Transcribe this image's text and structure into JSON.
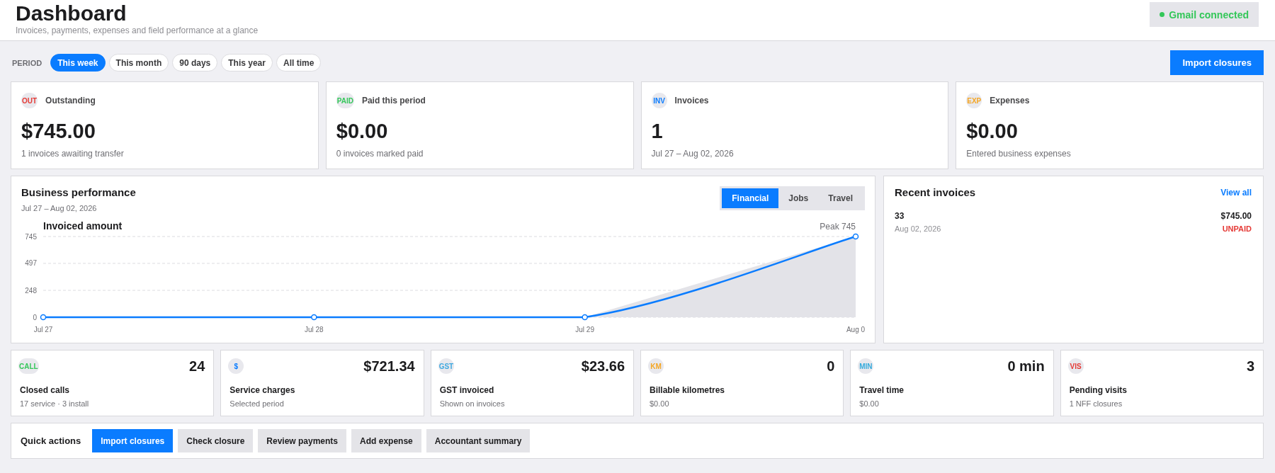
{
  "header": {
    "title": "Dashboard",
    "subtitle": "Invoices, payments, expenses and field performance at a glance",
    "connection": {
      "label": "Gmail connected",
      "connected": true
    }
  },
  "period": {
    "label": "PERIOD",
    "options": [
      {
        "label": "This week",
        "selected": true
      },
      {
        "label": "This month",
        "selected": false
      },
      {
        "label": "90 days",
        "selected": false
      },
      {
        "label": "This year",
        "selected": false
      },
      {
        "label": "All time",
        "selected": false
      }
    ],
    "action": "Import closures"
  },
  "summary_cards": [
    {
      "tag": "OUT",
      "color": "#e53935",
      "label": "Outstanding",
      "value": "$745.00",
      "note": "1 invoices awaiting transfer"
    },
    {
      "tag": "PAID",
      "color": "#34c759",
      "label": "Paid this period",
      "value": "$0.00",
      "note": "0 invoices marked paid"
    },
    {
      "tag": "INV",
      "color": "#0a7cff",
      "label": "Invoices",
      "value": "1",
      "note": "Jul 27 – Aug 02, 2026"
    },
    {
      "tag": "EXP",
      "color": "#f5a623",
      "label": "Expenses",
      "value": "$0.00",
      "note": "Entered business expenses"
    }
  ],
  "performance": {
    "title": "Business performance",
    "range": "Jul 27 – Aug 02, 2026",
    "tabs": [
      {
        "label": "Financial",
        "selected": true
      },
      {
        "label": "Jobs",
        "selected": false
      },
      {
        "label": "Travel",
        "selected": false
      }
    ],
    "chart_data": {
      "type": "area",
      "categories": [
        "Jul 27",
        "Jul 28",
        "Jul 29",
        "Aug 0"
      ],
      "series": [
        {
          "name": "Invoiced amount",
          "color": "#0a7cff",
          "values": [
            0,
            0,
            0,
            745
          ]
        }
      ],
      "ylim": [
        0,
        745
      ],
      "yticks": [
        0,
        248,
        497,
        745
      ],
      "annotations": [
        {
          "text": "Peak 745"
        }
      ]
    }
  },
  "recent_invoices": {
    "title": "Recent invoices",
    "link": "View all",
    "items": [
      {
        "number": "33",
        "amount": "$745.00",
        "date": "Aug 02, 2026",
        "status": "UNPAID",
        "color": "#e53935"
      }
    ]
  },
  "metrics": [
    {
      "tag": "CALL",
      "color": "#34c759",
      "value": "24",
      "label": "Closed calls",
      "note": "17 service · 3 install"
    },
    {
      "tag": "$",
      "color": "#0a7cff",
      "value": "$721.34",
      "label": "Service charges",
      "note": "Selected period"
    },
    {
      "tag": "GST",
      "color": "#3fa9e0",
      "value": "$23.66",
      "label": "GST invoiced",
      "note": "Shown on invoices"
    },
    {
      "tag": "KM",
      "color": "#f5a623",
      "value": "0",
      "label": "Billable kilometres",
      "note": "$0.00"
    },
    {
      "tag": "MIN",
      "color": "#34aadc",
      "value": "0 min",
      "label": "Travel time",
      "note": "$0.00"
    },
    {
      "tag": "VIS",
      "color": "#e53935",
      "value": "3",
      "label": "Pending visits",
      "note": "1 NFF closures"
    }
  ],
  "quick_actions": {
    "title": "Quick actions",
    "buttons": [
      {
        "label": "Import closures",
        "kind": "primary"
      },
      {
        "label": "Check closure",
        "kind": "secondary"
      },
      {
        "label": "Review payments",
        "kind": "secondary"
      },
      {
        "label": "Add expense",
        "kind": "secondary"
      },
      {
        "label": "Accountant summary",
        "kind": "secondary"
      }
    ]
  }
}
